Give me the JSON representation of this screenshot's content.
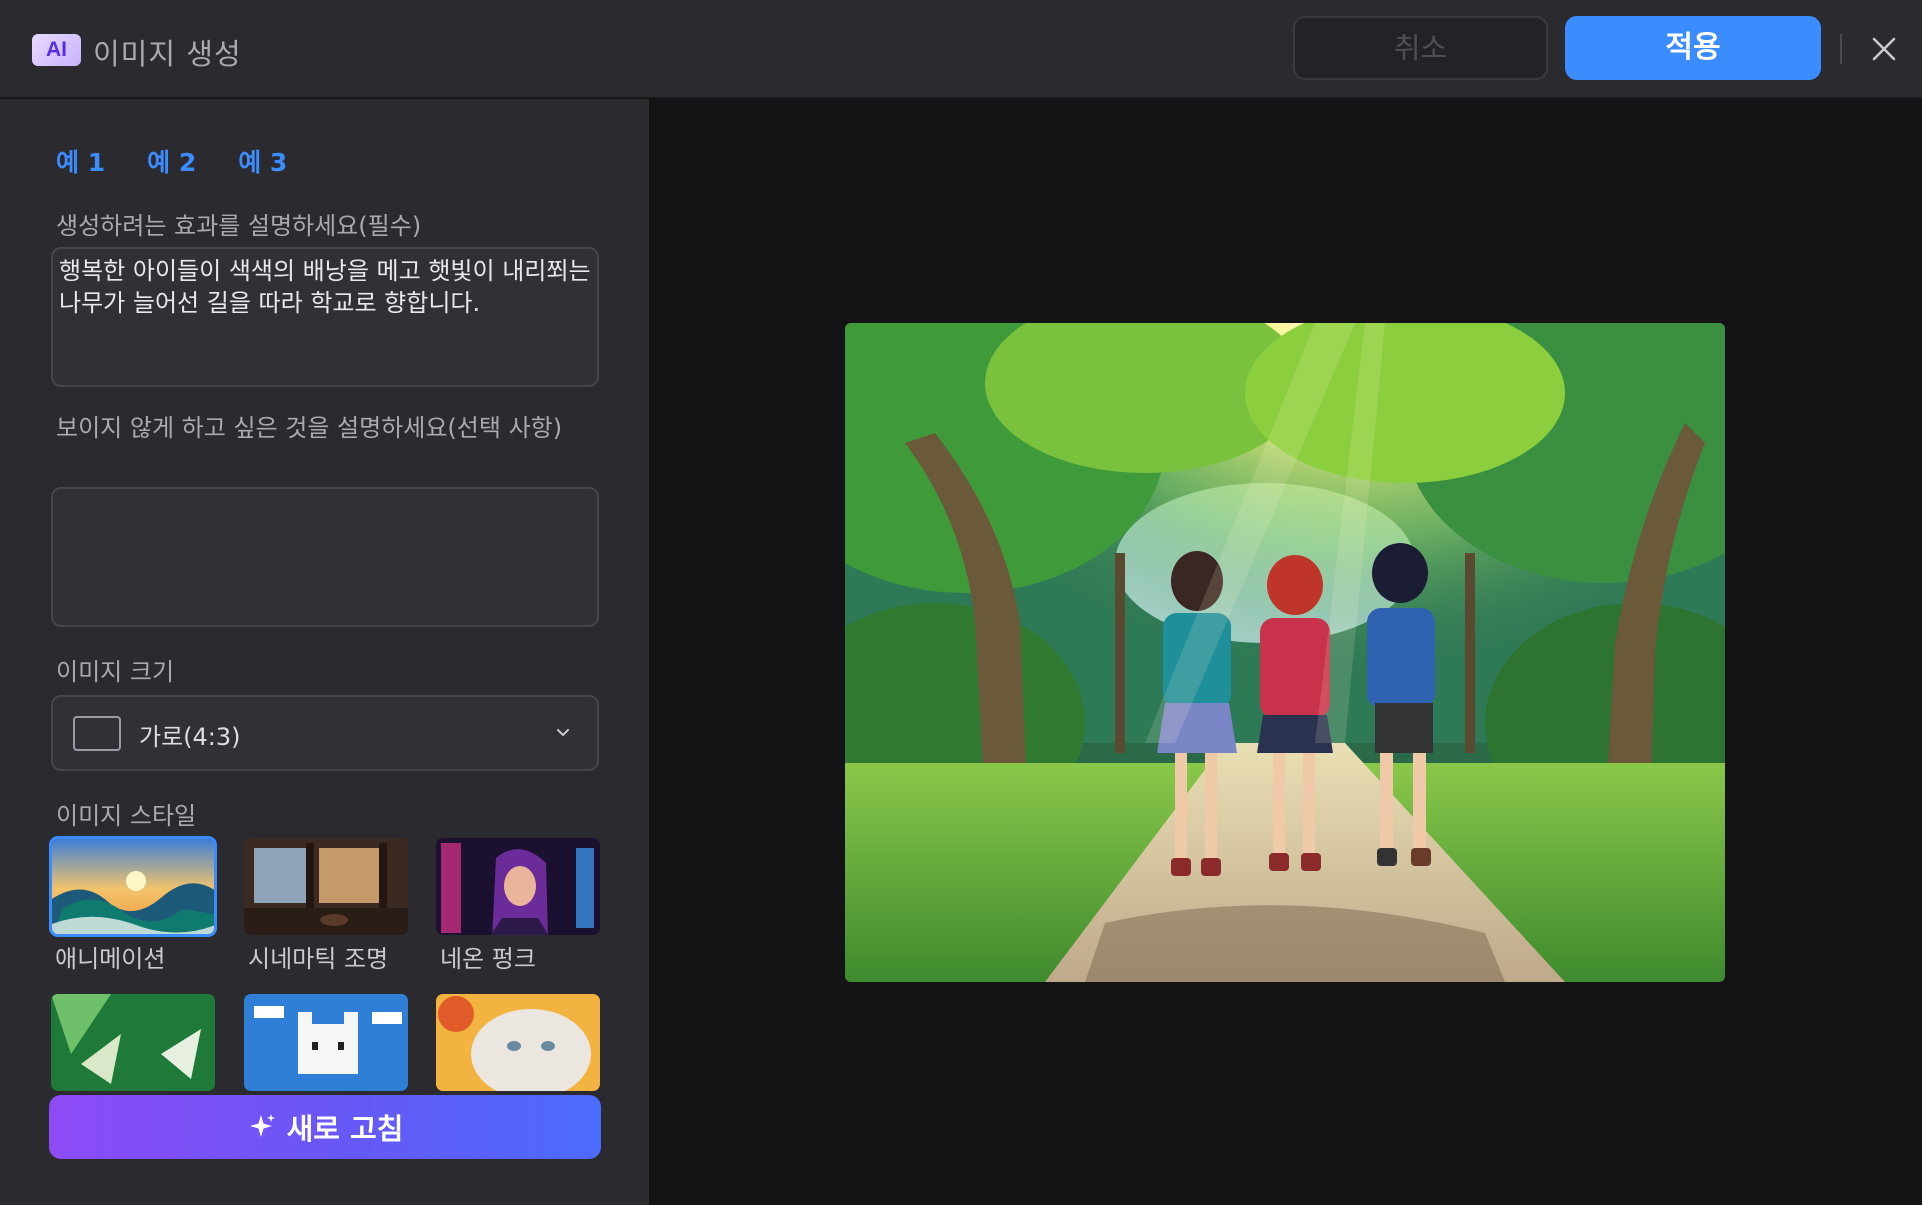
{
  "header": {
    "ai_badge": "AI",
    "title": "이미지 생성",
    "cancel_label": "취소",
    "apply_label": "적용",
    "close_icon": "close-icon"
  },
  "tabs": [
    {
      "label": "예 1"
    },
    {
      "label": "예 2"
    },
    {
      "label": "예 3"
    }
  ],
  "prompt": {
    "label": "생성하려는 효과를 설명하세요(필수)",
    "value": "행복한 아이들이 색색의 배낭을 메고 햇빛이 내리쬐는 나무가 늘어선 길을 따라 학교로 향합니다."
  },
  "negative_prompt": {
    "label": "보이지 않게 하고 싶은 것을 설명하세요(선택 사항)",
    "value": ""
  },
  "image_size": {
    "label": "이미지 크기",
    "selected": "가로(4:3)"
  },
  "image_style": {
    "label": "이미지 스타일",
    "items": [
      {
        "label": "애니메이션",
        "selected": true
      },
      {
        "label": "시네마틱 조명",
        "selected": false
      },
      {
        "label": "네온 펑크",
        "selected": false
      },
      {
        "label": "",
        "selected": false
      },
      {
        "label": "",
        "selected": false
      },
      {
        "label": "",
        "selected": false
      }
    ]
  },
  "refresh_label": "새로 고침",
  "colors": {
    "accent": "#3b8cff",
    "panel": "#2a2a2f",
    "canvas": "#141417"
  }
}
